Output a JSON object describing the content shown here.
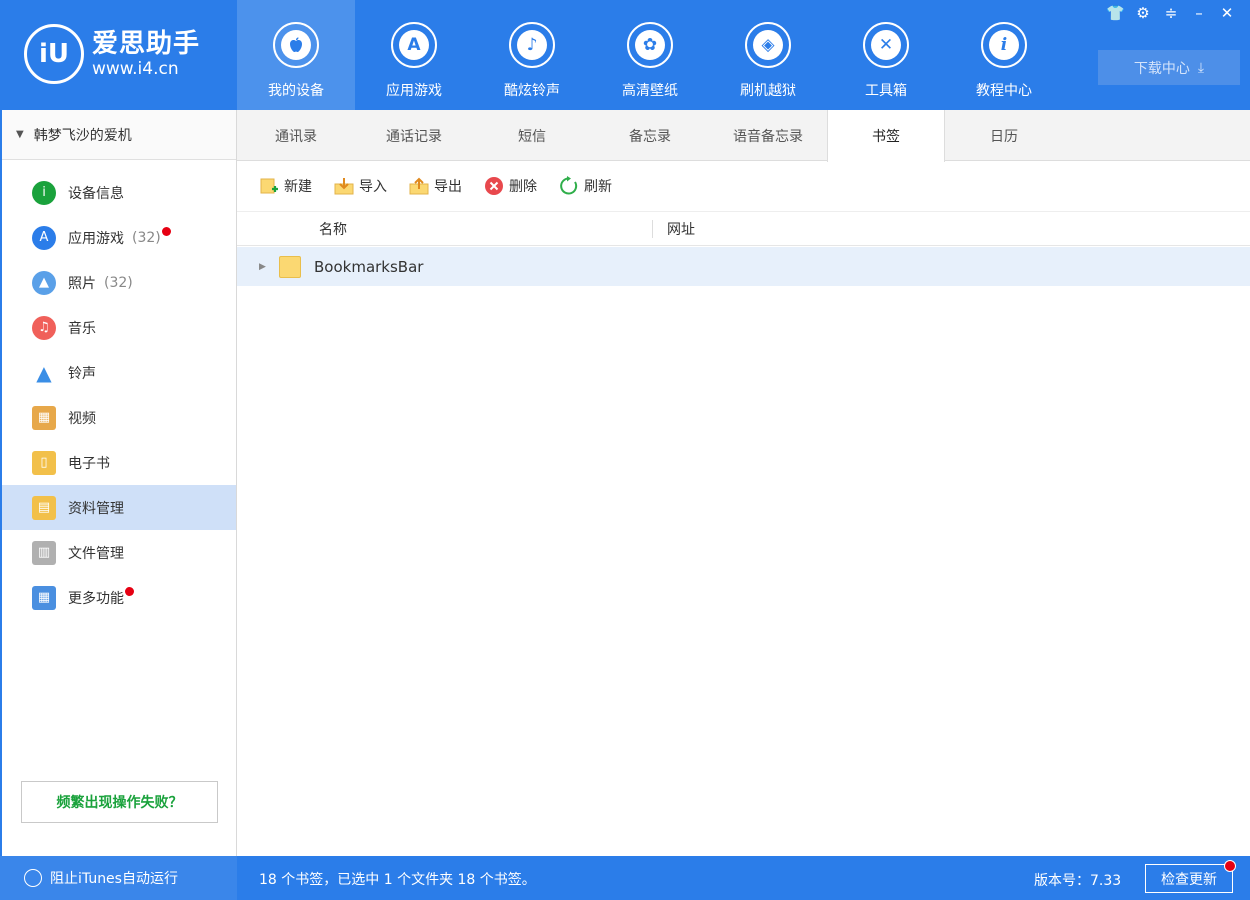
{
  "logo": {
    "mark": "iU",
    "title": "爱思助手",
    "url": "www.i4.cn"
  },
  "nav": [
    {
      "label": "我的设备",
      "icon": "apple-icon",
      "glyph": ""
    },
    {
      "label": "应用游戏",
      "icon": "app-store-icon",
      "glyph": "A"
    },
    {
      "label": "酷炫铃声",
      "icon": "bell-icon",
      "glyph": "♪"
    },
    {
      "label": "高清壁纸",
      "icon": "flower-icon",
      "glyph": "✿"
    },
    {
      "label": "刷机越狱",
      "icon": "box-icon",
      "glyph": "◈"
    },
    {
      "label": "工具箱",
      "icon": "tools-icon",
      "glyph": "✕"
    },
    {
      "label": "教程中心",
      "icon": "info-icon",
      "glyph": "i"
    }
  ],
  "window_controls": {
    "skin": "👕",
    "settings": "⚙",
    "menu": "≑",
    "minimize": "–",
    "close": "✕"
  },
  "download_center": {
    "label": "下载中心",
    "icon": "⤓"
  },
  "device": {
    "name": "韩梦飞沙的爱机",
    "caret": "▼"
  },
  "sidebar": [
    {
      "label": "设备信息",
      "count": "",
      "dot": false,
      "icon": "info-circle-icon",
      "glyph": "i",
      "color": "#1aa23c"
    },
    {
      "label": "应用游戏",
      "count": "(32)",
      "dot": true,
      "icon": "app-store-icon",
      "glyph": "A",
      "color": "#2b7de9"
    },
    {
      "label": "照片",
      "count": "(32)",
      "dot": false,
      "icon": "photo-icon",
      "glyph": "▲",
      "color": "#5aa0e8"
    },
    {
      "label": "音乐",
      "count": "",
      "dot": false,
      "icon": "music-icon",
      "glyph": "♫",
      "color": "#f0605a"
    },
    {
      "label": "铃声",
      "count": "",
      "dot": false,
      "icon": "bell-icon",
      "glyph": "▲",
      "color": "#3a8ee6"
    },
    {
      "label": "视频",
      "count": "",
      "dot": false,
      "icon": "film-icon",
      "glyph": "▦",
      "color": "#e7a84a"
    },
    {
      "label": "电子书",
      "count": "",
      "dot": false,
      "icon": "book-icon",
      "glyph": "▯",
      "color": "#f2c04a"
    },
    {
      "label": "资料管理",
      "count": "",
      "dot": false,
      "icon": "document-icon",
      "glyph": "▤",
      "color": "#f2c04a"
    },
    {
      "label": "文件管理",
      "count": "",
      "dot": false,
      "icon": "files-icon",
      "glyph": "▥",
      "color": "#b0b0b0"
    },
    {
      "label": "更多功能",
      "count": "",
      "dot": true,
      "icon": "grid-icon",
      "glyph": "▦",
      "color": "#4a8fe0"
    }
  ],
  "help_button": "频繁出现操作失败？",
  "tabs": [
    "通讯录",
    "通话记录",
    "短信",
    "备忘录",
    "语音备忘录",
    "书签",
    "日历"
  ],
  "active_tab": "书签",
  "toolbar": {
    "new": "新建",
    "import": "导入",
    "export": "导出",
    "delete": "删除",
    "refresh": "刷新"
  },
  "table": {
    "columns": {
      "name": "名称",
      "url": "网址"
    },
    "rows": [
      {
        "name": "BookmarksBar"
      }
    ]
  },
  "status": {
    "itunes": "阻止iTunes自动运行",
    "summary": "18 个书签，已选中 1 个文件夹 18 个书签。",
    "version": "版本号：7.33",
    "check_update": "检查更新"
  }
}
